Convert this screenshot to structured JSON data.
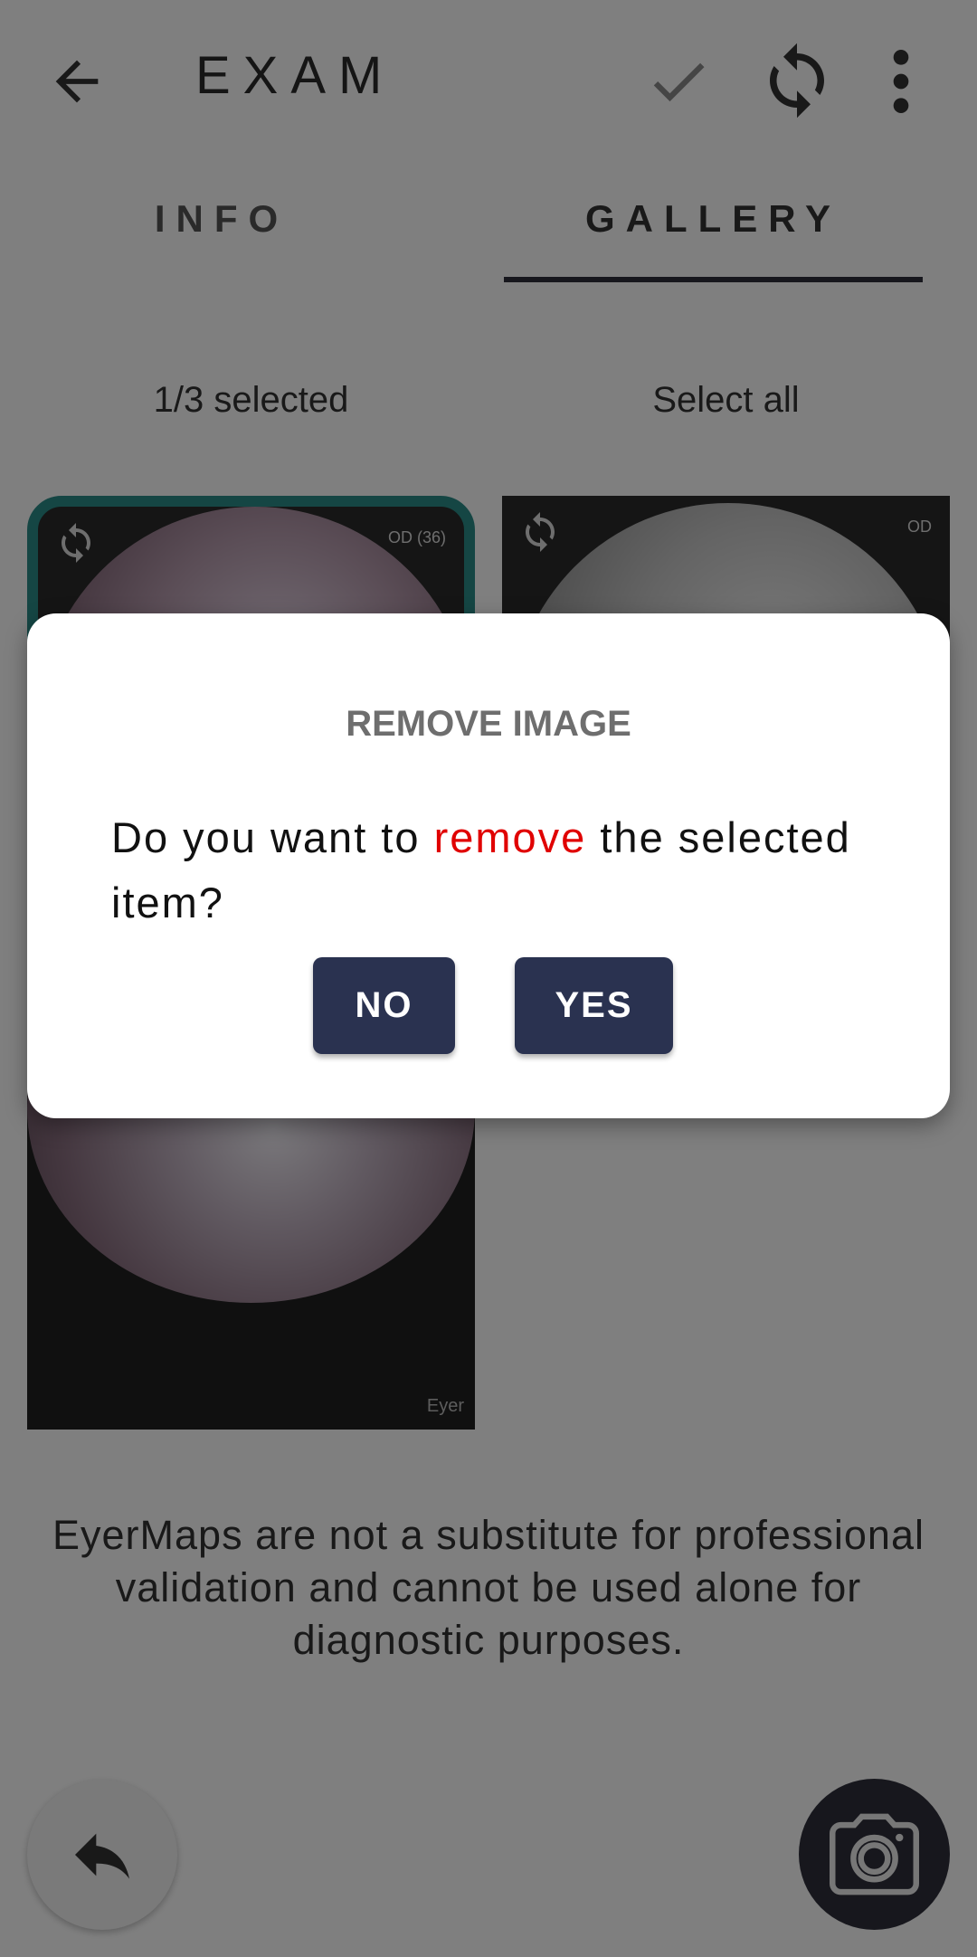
{
  "appbar": {
    "title": "EXAM",
    "back_icon": "arrow-left-icon",
    "actions": [
      "check-icon",
      "sync-icon",
      "more-vert-icon"
    ]
  },
  "tabs": [
    {
      "label": "INFO",
      "selected": false
    },
    {
      "label": "GALLERY",
      "selected": true
    }
  ],
  "selection": {
    "count_text": "1/3 selected",
    "select_all_label": "Select all"
  },
  "gallery": {
    "images": [
      {
        "eye_label": "OD (36)",
        "selected": true
      },
      {
        "eye_label": "OD",
        "selected": false
      },
      {
        "brand": "Eyer",
        "selected": false
      }
    ]
  },
  "disclaimer": "EyerMaps are not a substitute for professional validation and cannot be used alone for diagnostic purposes.",
  "fabs": {
    "back_icon": "reply-icon",
    "camera_icon": "camera-icon"
  },
  "dialog": {
    "title": "REMOVE IMAGE",
    "message_part1": "Do you want to ",
    "message_highlight": "remove",
    "message_part2": " the selected item?",
    "no_label": "NO",
    "yes_label": "YES"
  },
  "colors": {
    "accent_teal": "#2a8d89",
    "button_navy": "#2a3250",
    "danger_red": "#e00000",
    "dark_fab": "#2e2f3b"
  }
}
